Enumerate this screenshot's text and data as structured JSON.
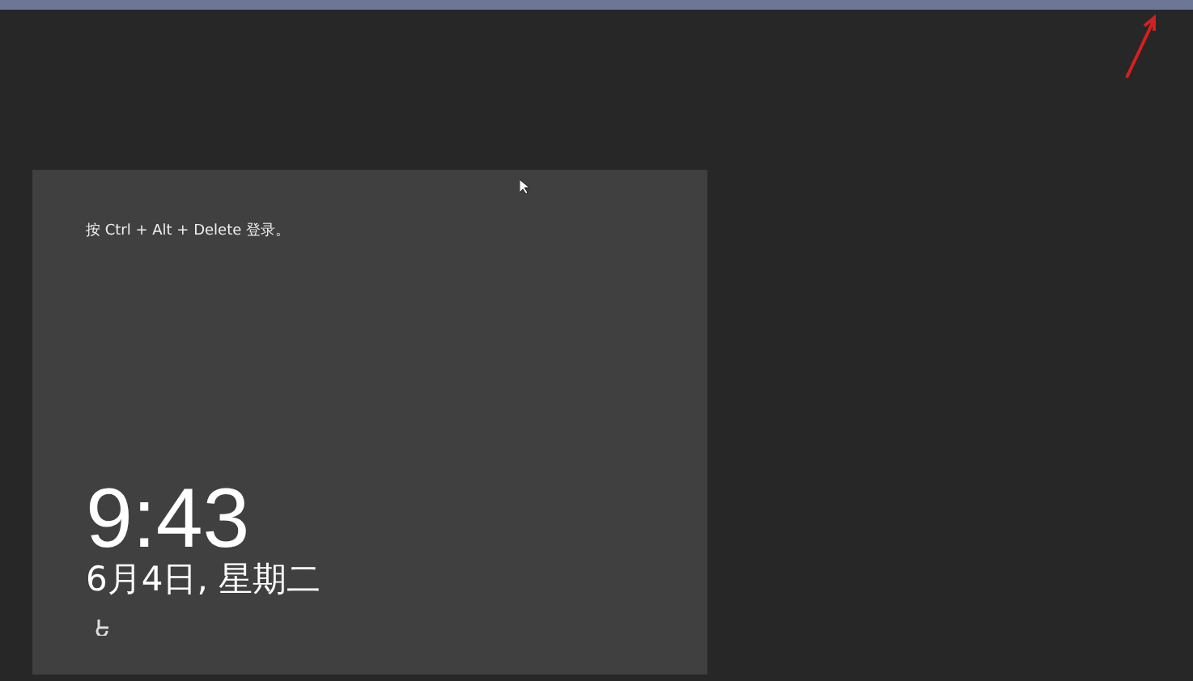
{
  "lock_screen": {
    "prompt": "按 Ctrl + Alt + Delete 登录。",
    "time": "9:43",
    "date": "6月4日, 星期二"
  }
}
